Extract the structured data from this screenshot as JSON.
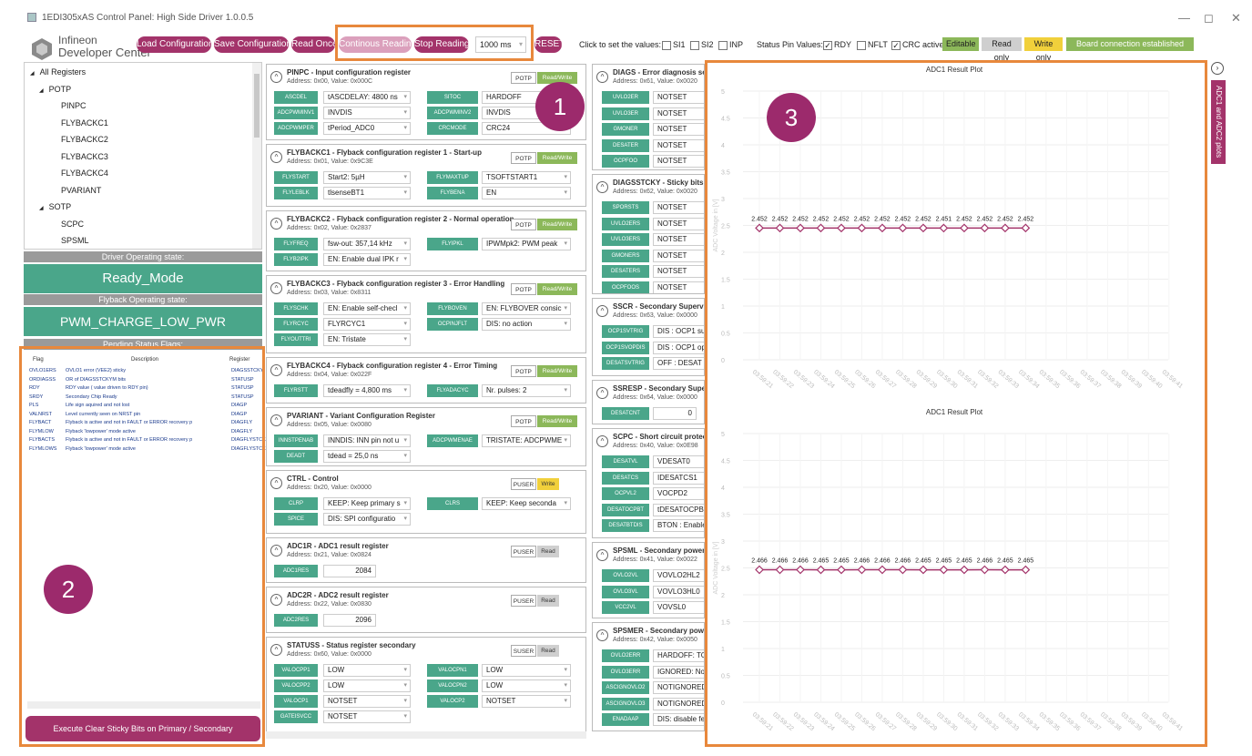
{
  "window": {
    "title": "1EDI305xAS Control Panel: High Side Driver 1.0.0.5",
    "minimize": "—",
    "maximize": "◻",
    "close": "✕"
  },
  "brand": {
    "line1": "Infineon",
    "line2": "Developer Center"
  },
  "toolbar": {
    "load": "Load Configuration",
    "save": "Save Configuration",
    "read_once": "Read Once",
    "continuous": "Continous Reading",
    "stop": "Stop Reading",
    "interval": "1000 ms",
    "reset": "RESET",
    "click_text": "Click to set the values:",
    "si1": "SI1",
    "si2": "SI2",
    "inp": "INP",
    "status_text": "Status Pin Values:",
    "rdy": "RDY",
    "nflt": "NFLT",
    "crc": "CRC active",
    "editable": "Editable",
    "read_only": "Read only",
    "write_only": "Write only",
    "board": "Board connection established",
    "check": "✓",
    "dropdown": "▾",
    "editable_color": "#8cb85a",
    "readonly_color": "#cfcfcf",
    "writeonly_color": "#f1d03b",
    "board_color": "#8cb85a"
  },
  "annotations": {
    "n1": "1",
    "n2": "2",
    "n3": "3"
  },
  "tree": [
    {
      "label": "All Registers",
      "toggle": "◢"
    },
    {
      "label": "POTP",
      "toggle": "◢"
    },
    {
      "label": "PINPC"
    },
    {
      "label": "FLYBACKC1"
    },
    {
      "label": "FLYBACKC2"
    },
    {
      "label": "FLYBACKC3"
    },
    {
      "label": "FLYBACKC4"
    },
    {
      "label": "PVARIANT"
    },
    {
      "label": "SOTP",
      "toggle": "◢"
    },
    {
      "label": "SCPC"
    },
    {
      "label": "SPSML"
    }
  ],
  "driver_state": {
    "label": "Driver Operating state:",
    "value": "Ready_Mode"
  },
  "flyback_state": {
    "label": "Flyback Operating state:",
    "value": "PWM_CHARGE_LOW_PWR"
  },
  "pending": {
    "label": "Pending Status Flags:",
    "col_flag": "Flag",
    "col_desc": "Description",
    "col_reg": "Register",
    "rows": [
      {
        "flag": "OVLO1ERS",
        "desc": "OVLO1 error (VEE2) sticky",
        "reg": "DIAGSSTCKY"
      },
      {
        "flag": "ORDIAGSS",
        "desc": "OR of DIAGSSTCKYM bits",
        "reg": "STATUSP"
      },
      {
        "flag": "RDY",
        "desc": "RDY value ( value driven to RDY pin)",
        "reg": "STATUSP"
      },
      {
        "flag": "SRDY",
        "desc": "Secondary Chip Ready",
        "reg": "STATUSP"
      },
      {
        "flag": "PLS",
        "desc": "Life sign aquired and not lost",
        "reg": "DIAGP"
      },
      {
        "flag": "VALNRST",
        "desc": "Level currently seen on NRST pin",
        "reg": "DIAGP"
      },
      {
        "flag": "FLYBACT",
        "desc": "Flyback is active and not in FAULT or ERROR recovery p",
        "reg": "DIAGFLY"
      },
      {
        "flag": "FLYMLOW",
        "desc": "Flyback 'lowpower' mode active",
        "reg": "DIAGFLY"
      },
      {
        "flag": "FLYBACTS",
        "desc": "Flyback is active and not in FAULT or ERROR recovery p",
        "reg": "DIAGFLYSTCKY"
      },
      {
        "flag": "FLYMLOWS",
        "desc": "Flyback 'lowpower' mode active",
        "reg": "DIAGFLYSTCKY"
      }
    ]
  },
  "clear_button": "Execute Clear Sticky Bits on Primary / Secondary",
  "chevron": "^",
  "registers_mid": [
    {
      "title": "PINPC - Input configuration register",
      "addr": "Address: 0x00, Value: 0x000C",
      "tag1": "POTP",
      "tag2": "Read/Write",
      "t2cls": "rw",
      "fields": [
        [
          "ASCDEL",
          "tASCDELAY: 4800 ns",
          "SITOC",
          "HARDOFF"
        ],
        [
          "ADCPWMINV1",
          "INVDIS",
          "ADCPWMINV2",
          "INVDIS"
        ],
        [
          "ADCPWMPER",
          "tPeriod_ADC0",
          "CRCMODE",
          "CRC24"
        ]
      ]
    },
    {
      "title": "FLYBACKC1 - Flyback configuration register 1 - Start-up",
      "addr": "Address: 0x01, Value: 0x9C3E",
      "tag1": "POTP",
      "tag2": "Read/Write",
      "t2cls": "rw",
      "fields": [
        [
          "FLYSTART",
          "Start2: 5µH",
          "FLYMAXTUP",
          "TSOFTSTART1"
        ],
        [
          "FLYLEBLK",
          "tlsenseBT1",
          "FLYBENA",
          "EN"
        ]
      ]
    },
    {
      "title": "FLYBACKC2 - Flyback configuration register 2 - Normal operation",
      "addr": "Address: 0x02, Value: 0x2837",
      "tag1": "POTP",
      "tag2": "Read/Write",
      "t2cls": "rw",
      "fields": [
        [
          "FLYFREQ",
          "fsw-out: 357,14 kHz",
          "FLYIPKL",
          "IPWMpk2: PWM peak"
        ],
        [
          "FLYB2IPK",
          "EN: Enable dual IPK r",
          "",
          ""
        ]
      ]
    },
    {
      "title": "FLYBACKC3 - Flyback configuration register 3 - Error Handling",
      "addr": "Address: 0x03, Value: 0x8311",
      "tag1": "POTP",
      "tag2": "Read/Write",
      "t2cls": "rw",
      "fields": [
        [
          "FLYSCHK",
          "EN: Enable self-checl",
          "FLYBOVEN",
          "EN: FLYBOVER consic"
        ],
        [
          "FLYRCYC",
          "FLYRCYC1",
          "OCPINJFLT",
          "DIS: no action"
        ],
        [
          "FLYOUTTRI",
          "EN: Tristate",
          "",
          ""
        ]
      ]
    },
    {
      "title": "FLYBACKC4 - Flyback configuration register 4 - Error Timing",
      "addr": "Address: 0x04, Value: 0x022F",
      "tag1": "POTP",
      "tag2": "Read/Write",
      "t2cls": "rw",
      "fields": [
        [
          "FLYRSTT",
          "tdeadfly = 4,800 ms",
          "FLYADACYC",
          "Nr. pulses: 2"
        ]
      ]
    },
    {
      "title": "PVARIANT - Variant Configuration Register",
      "addr": "Address: 0x05, Value: 0x0080",
      "tag1": "POTP",
      "tag2": "Read/Write",
      "t2cls": "rw",
      "fields": [
        [
          "INNSTPENAB",
          "INNDIS: INN pin not u",
          "ADCPWMENAE",
          "TRISTATE: ADCPWME"
        ],
        [
          "DEADT",
          "tdead = 25,0 ns",
          "",
          ""
        ]
      ]
    },
    {
      "title": "CTRL - Control",
      "addr": "Address: 0x20, Value: 0x0000",
      "tag1": "PUSER",
      "tag2": "Write",
      "t2cls": "w",
      "fields": [
        [
          "CLRP",
          "KEEP: Keep primary s",
          "CLRS",
          "KEEP: Keep seconda"
        ],
        [
          "SPICE",
          "DIS: SPI configuratio",
          "",
          ""
        ]
      ]
    },
    {
      "title": "ADC1R - ADC1 result register",
      "addr": "Address: 0x21, Value: 0x0824",
      "tag1": "PUSER",
      "tag2": "Read",
      "t2cls": "r",
      "fields": [
        [
          "ADC1RES",
          "2084",
          "",
          ""
        ]
      ]
    },
    {
      "title": "ADC2R - ADC2 result register",
      "addr": "Address: 0x22, Value: 0x0830",
      "tag1": "PUSER",
      "tag2": "Read",
      "t2cls": "r",
      "fields": [
        [
          "ADC2RES",
          "2096",
          "",
          ""
        ]
      ]
    },
    {
      "title": "STATUSS - Status register secondary",
      "addr": "Address: 0x60, Value: 0x0000",
      "tag1": "SUSER",
      "tag2": "Read",
      "t2cls": "r",
      "fields": [
        [
          "VALOCPP1",
          "LOW",
          "VALOCPN1",
          "LOW"
        ],
        [
          "VALOCPP2",
          "LOW",
          "VALOCPN2",
          "LOW"
        ],
        [
          "VALOCP1",
          "NOTSET",
          "VALOCP2",
          "NOTSET"
        ],
        [
          "GATEISVCC",
          "NOTSET",
          "",
          ""
        ]
      ]
    }
  ],
  "registers_right": [
    {
      "title": "DIAGS - Error diagnosis secondary",
      "addr": "Address: 0x61, Value: 0x0020",
      "fields": [
        [
          "UVLO2ER",
          "NOTSET"
        ],
        [
          "UVLO3ER",
          "NOTSET"
        ],
        [
          "GMONER",
          "NOTSET"
        ],
        [
          "DESATER",
          "NOTSET"
        ],
        [
          "OCPFOO",
          "NOTSET"
        ]
      ]
    },
    {
      "title": "DIAGSSTCKY - Sticky bits secondary",
      "addr": "Address: 0x62, Value: 0x0020",
      "fields": [
        [
          "SPORSTS",
          "NOTSET"
        ],
        [
          "UVLO2ERS",
          "NOTSET"
        ],
        [
          "UVLO3ERS",
          "NOTSET"
        ],
        [
          "GMONERS",
          "NOTSET"
        ],
        [
          "DESATERS",
          "NOTSET"
        ],
        [
          "OCPFOOS",
          "NOTSET"
        ]
      ]
    },
    {
      "title": "SSCR - Secondary Supervision",
      "addr": "Address: 0x63, Value: 0x0000",
      "fields": [
        [
          "OCP1SVTRIG",
          "DIS : OCP1 su"
        ],
        [
          "OCP1SVOPDIS",
          "DIS : OCP1 op"
        ],
        [
          "DESATSVTRIG",
          "OFF : DESAT s"
        ]
      ]
    },
    {
      "title": "SSRESP - Secondary Supervision",
      "addr": "Address: 0x64, Value: 0x0000",
      "fields": [
        [
          "DESATCNT",
          "0"
        ]
      ]
    },
    {
      "title": "SCPC - Short circuit protection",
      "addr": "Address: 0x40, Value: 0x0E98",
      "fields": [
        [
          "DESATVL",
          "VDESAT0"
        ],
        [
          "DESATCS",
          "IDESATCS1"
        ],
        [
          "OCPVL2",
          "VOCPD2"
        ],
        [
          "DESATOCPBT",
          "tDESATOCPBT"
        ],
        [
          "DESATBTDIS",
          "BTON : Enable"
        ]
      ]
    },
    {
      "title": "SPSML - Secondary power supply",
      "addr": "Address: 0x41, Value: 0x0022",
      "fields": [
        [
          "OVLO2VL",
          "VOVLO2HL2"
        ],
        [
          "OVLO3VL",
          "VOVLO3HL0"
        ],
        [
          "VCC2VL",
          "VOVSL0"
        ]
      ]
    },
    {
      "title": "SPSMER - Secondary power supply",
      "addr": "Address: 0x42, Value: 0x0050",
      "fields": [
        [
          "OVLO2ERR",
          "HARDOFF: TO"
        ],
        [
          "OVLO3ERR",
          "IGNORED: No"
        ],
        [
          "ASCIGNOVLO2",
          "NOTIGNORED"
        ],
        [
          "ASCIGNOVLO3",
          "NOTIGNORED"
        ],
        [
          "ENADAAP",
          "DIS: disable fe"
        ]
      ]
    }
  ],
  "side_tab": "ADC1 and ADC2 plots",
  "side_circle": "›",
  "chart_data": [
    {
      "type": "line",
      "title": "ADC1 Result Plot",
      "ylabel": "ADC Voltage in [V]",
      "xlabel": "",
      "ylim": [
        0,
        5
      ],
      "yticks": [
        "0",
        "0.5",
        "1",
        "1.5",
        "2",
        "2.5",
        "3",
        "3.5",
        "4",
        "4.5",
        "5"
      ],
      "x": [
        "03:59:21",
        "03:59:22",
        "03:59:23",
        "03:59:24",
        "03:59:25",
        "03:59:26",
        "03:59:27",
        "03:59:28",
        "03:59:29",
        "03:59:30",
        "03:59:31",
        "03:59:32",
        "03:59:33",
        "03:59:34",
        "03:59:35",
        "03:59:36",
        "03:59:37",
        "03:59:38",
        "03:59:39",
        "03:59:40",
        "03:59:41"
      ],
      "values": [
        2.452,
        2.452,
        2.452,
        2.452,
        2.452,
        2.452,
        2.452,
        2.452,
        2.452,
        2.451,
        2.452,
        2.452,
        2.452,
        2.452
      ],
      "labels": [
        "2.452",
        "2.452",
        "2.452",
        "2.452",
        "2.452",
        "2.452",
        "2.452",
        "2.452",
        "2.452",
        "2.451",
        "2.452",
        "2.452",
        "2.452",
        "2.452"
      ],
      "color": "#a3336a"
    },
    {
      "type": "line",
      "title": "ADC1 Result Plot",
      "ylabel": "ADC Voltage in [V]",
      "xlabel": "",
      "ylim": [
        0,
        5
      ],
      "yticks": [
        "0",
        "0.5",
        "1",
        "1.5",
        "2",
        "2.5",
        "3",
        "3.5",
        "4",
        "4.5",
        "5"
      ],
      "x": [
        "03:59:21",
        "03:59:22",
        "03:59:23",
        "03:59:24",
        "03:59:25",
        "03:59:26",
        "03:59:27",
        "03:59:28",
        "03:59:29",
        "03:59:30",
        "03:59:31",
        "03:59:32",
        "03:59:33",
        "03:59:34",
        "03:59:35",
        "03:59:36",
        "03:59:37",
        "03:59:38",
        "03:59:39",
        "03:59:40",
        "03:59:41"
      ],
      "values": [
        2.466,
        2.466,
        2.466,
        2.465,
        2.465,
        2.466,
        2.466,
        2.466,
        2.465,
        2.465,
        2.465,
        2.466,
        2.465,
        2.465
      ],
      "labels": [
        "2.466",
        "2.466",
        "2.466",
        "2.465",
        "2.465",
        "2.466",
        "2.466",
        "2.466",
        "2.465",
        "2.465",
        "2.465",
        "2.466",
        "2.465",
        "2.465"
      ],
      "color": "#a3336a"
    }
  ]
}
